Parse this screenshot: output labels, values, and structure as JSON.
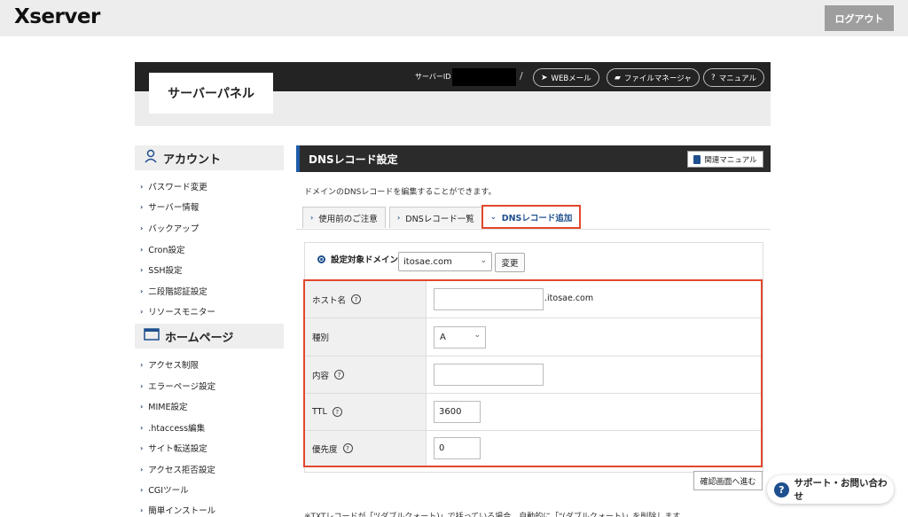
{
  "header": {
    "logo": "Xserver",
    "logout_label": "ログアウト"
  },
  "panel": {
    "title": "サーバーパネル",
    "server_id_label": "サーバーID",
    "separator": "/",
    "webmail_label": "WEBメール",
    "filemanager_label": "ファイルマネージャ",
    "manual_label": "マニュアル"
  },
  "sidebar": {
    "sections": [
      {
        "title": "アカウント",
        "icon": "user-icon",
        "items": [
          "パスワード変更",
          "サーバー情報",
          "バックアップ",
          "Cron設定",
          "SSH設定",
          "二段階認証設定",
          "リソースモニター"
        ]
      },
      {
        "title": "ホームページ",
        "icon": "window-icon",
        "items": [
          "アクセス制限",
          "エラーページ設定",
          "MIME設定",
          ".htaccess編集",
          "サイト転送設定",
          "アクセス拒否設定",
          "CGIツール",
          "簡単インストール"
        ]
      }
    ]
  },
  "main": {
    "title": "DNSレコード設定",
    "manual_button": "関連マニュアル",
    "description": "ドメインのDNSレコードを編集することができます。",
    "tabs": [
      {
        "label": "使用前のご注意",
        "active": false
      },
      {
        "label": "DNSレコード一覧",
        "active": false
      },
      {
        "label": "DNSレコード追加",
        "active": true
      }
    ],
    "domain": {
      "label": "設定対象ドメイン",
      "value": "itosae.com",
      "change_label": "変更"
    },
    "form": {
      "host": {
        "label": "ホスト名",
        "value": "",
        "suffix": ".itosae.com"
      },
      "type": {
        "label": "種別",
        "value": "A"
      },
      "content": {
        "label": "内容",
        "value": ""
      },
      "ttl": {
        "label": "TTL",
        "value": "3600"
      },
      "priority": {
        "label": "優先度",
        "value": "0"
      }
    },
    "confirm_label": "確認画面へ進む",
    "note": "※TXTレコードが「\"(ダブルクォート)」で括っている場合、自動的に「\"(ダブルクォート)」を削除します。"
  },
  "support": {
    "label": "サポート・お問い合わせ",
    "icon": "question-icon"
  },
  "colors": {
    "accent_red": "#e2472b",
    "brand_blue": "#1e4f8e",
    "dark_bar": "#232323"
  }
}
